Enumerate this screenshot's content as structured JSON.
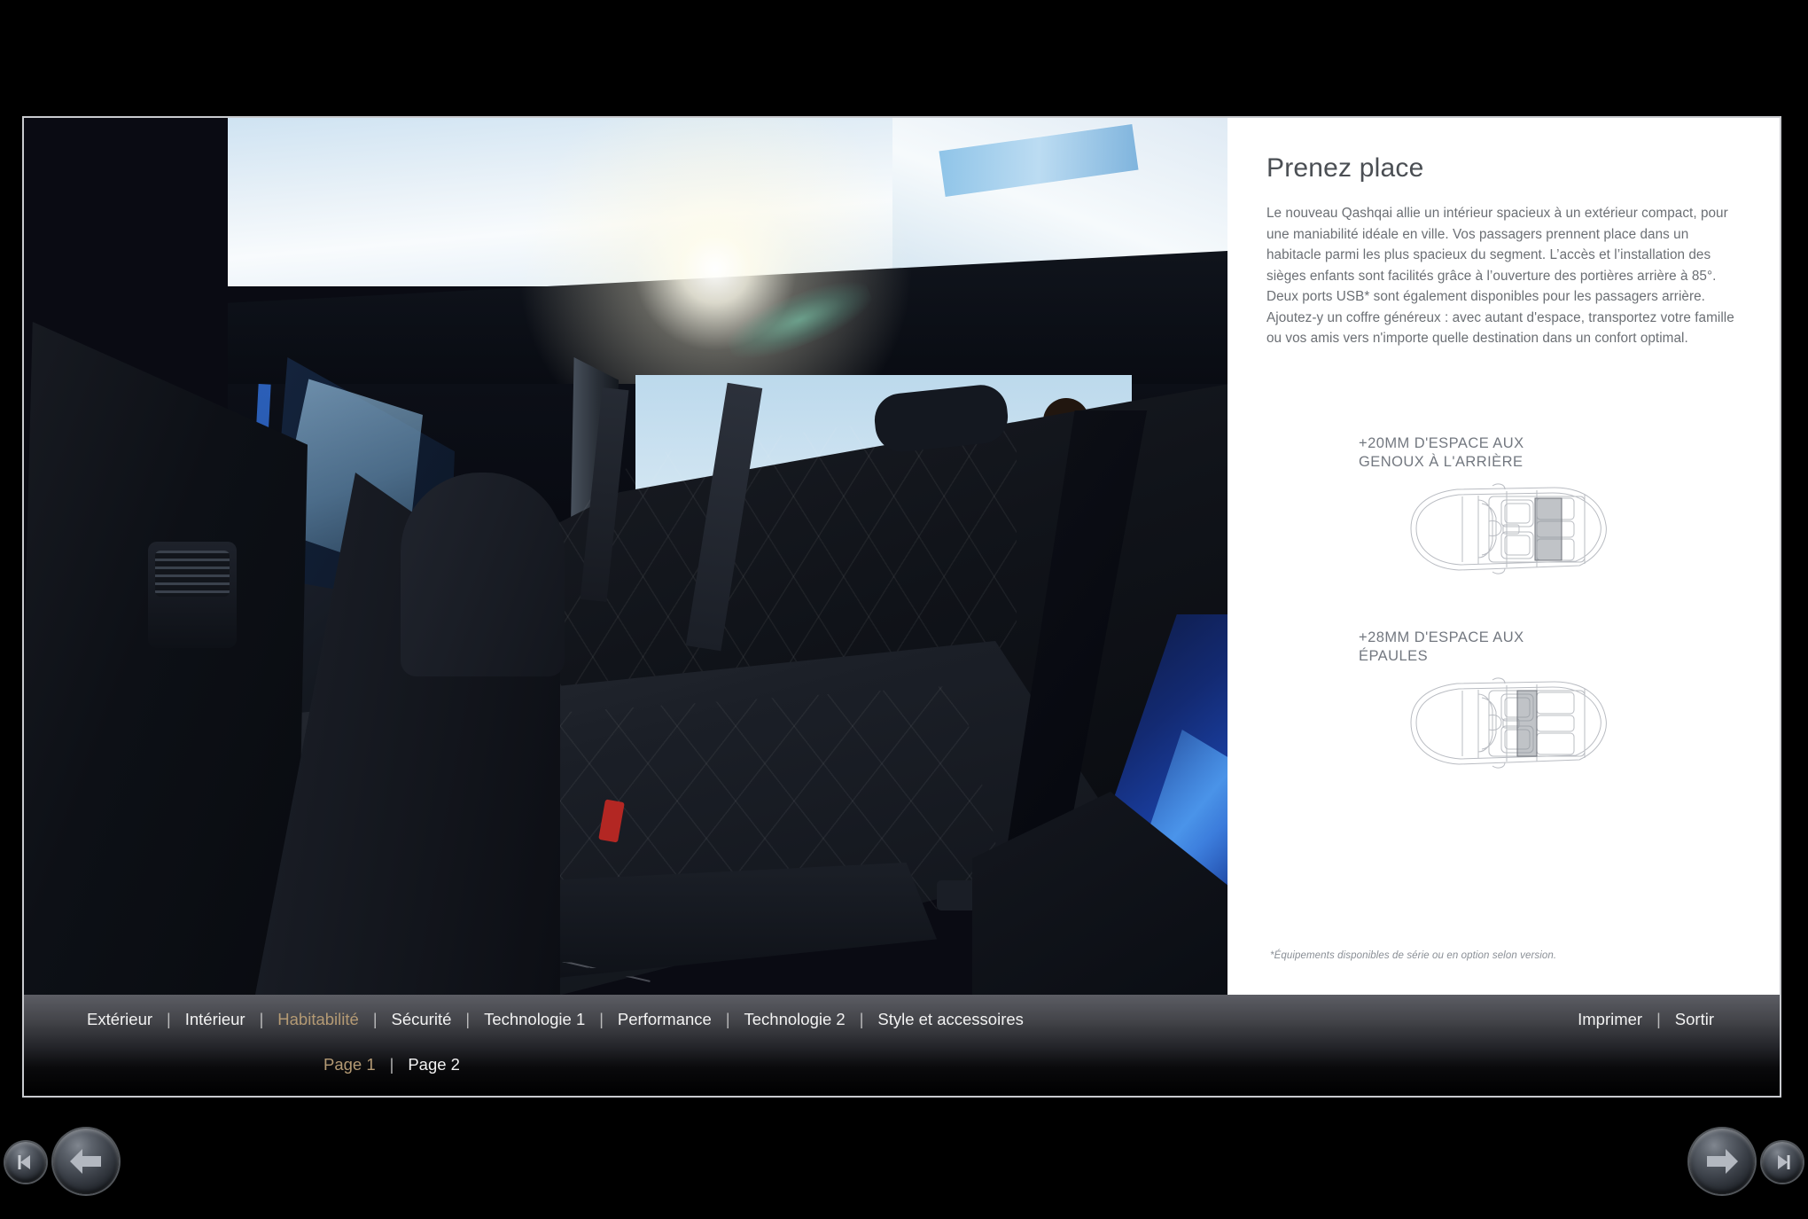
{
  "document": {
    "title": "Prenez place"
  },
  "panel": {
    "heading": "Prenez place",
    "body": "Le nouveau Qashqai allie un intérieur spacieux à un extérieur compact, pour une maniabilité idéale en ville. Vos passagers prennent place dans un habitacle parmi les plus spacieux du segment. L’accès et l’installation des sièges enfants sont facilités grâce à l’ouverture des portières arrière à 85°. Deux ports USB* sont également disponibles pour les passagers arrière. Ajoutez-y un coffre généreux : avec autant d'espace, transportez votre famille ou vos amis vers n'importe quelle destination dans un confort optimal.",
    "footnote": "*Équipements disponibles de série ou en option selon version.",
    "specs": [
      {
        "label": "+20MM D'ESPACE AUX\nGENOUX À L'ARRIÈRE",
        "figure": "car-top-view-rear-knee-room",
        "highlight": "rear-seat-area"
      },
      {
        "label": "+28MM D'ESPACE AUX\nÉPAULES",
        "figure": "car-top-view-shoulder-room",
        "highlight": "front-seat-shoulder-band"
      }
    ]
  },
  "photo": {
    "alt": "rear-seat-interior-with-open-door"
  },
  "nav": {
    "sections": [
      {
        "label": "Extérieur",
        "active": false
      },
      {
        "label": "Intérieur",
        "active": false
      },
      {
        "label": "Habitabilité",
        "active": true
      },
      {
        "label": "Sécurité",
        "active": false
      },
      {
        "label": "Technologie 1",
        "active": false
      },
      {
        "label": "Performance",
        "active": false
      },
      {
        "label": "Technologie 2",
        "active": false
      },
      {
        "label": "Style et accessoires",
        "active": false
      }
    ],
    "separator": "|",
    "actions": [
      {
        "label": "Imprimer"
      },
      {
        "label": "Sortir"
      }
    ],
    "pages": [
      {
        "label": "Page 1",
        "active": true
      },
      {
        "label": "Page 2",
        "active": false
      }
    ]
  },
  "controls": [
    {
      "name": "first-page-button",
      "icon": "skip-back-icon"
    },
    {
      "name": "previous-page-button",
      "icon": "arrow-left-icon"
    },
    {
      "name": "next-page-button",
      "icon": "arrow-right-icon"
    },
    {
      "name": "last-page-button",
      "icon": "skip-forward-icon"
    }
  ],
  "colors": {
    "accent": "#b49a74",
    "heading": "#4b4f54",
    "body_text": "#6b6f74",
    "spec_text": "#737880",
    "panel_bg": "#ffffff",
    "stage_bg": "#000000",
    "navbar_top": "#5c5d64"
  }
}
